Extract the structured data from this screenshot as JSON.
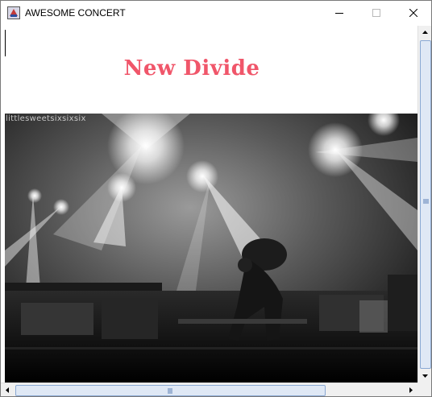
{
  "window": {
    "title": "AWESOME CONCERT",
    "icon": "java-app-icon",
    "controls": [
      "minimize-icon",
      "maximize-icon",
      "close-icon"
    ]
  },
  "content": {
    "heading": "New Divide",
    "heading_color": "#f0566a",
    "image_watermark": "littlesweetsixsixsix",
    "image_description_icon": "concert-stage-photo"
  },
  "colors": {
    "scroll_thumb": "#dfe8f5",
    "scroll_thumb_border": "#8aa9d4",
    "scroll_track": "#f0f0f0"
  }
}
